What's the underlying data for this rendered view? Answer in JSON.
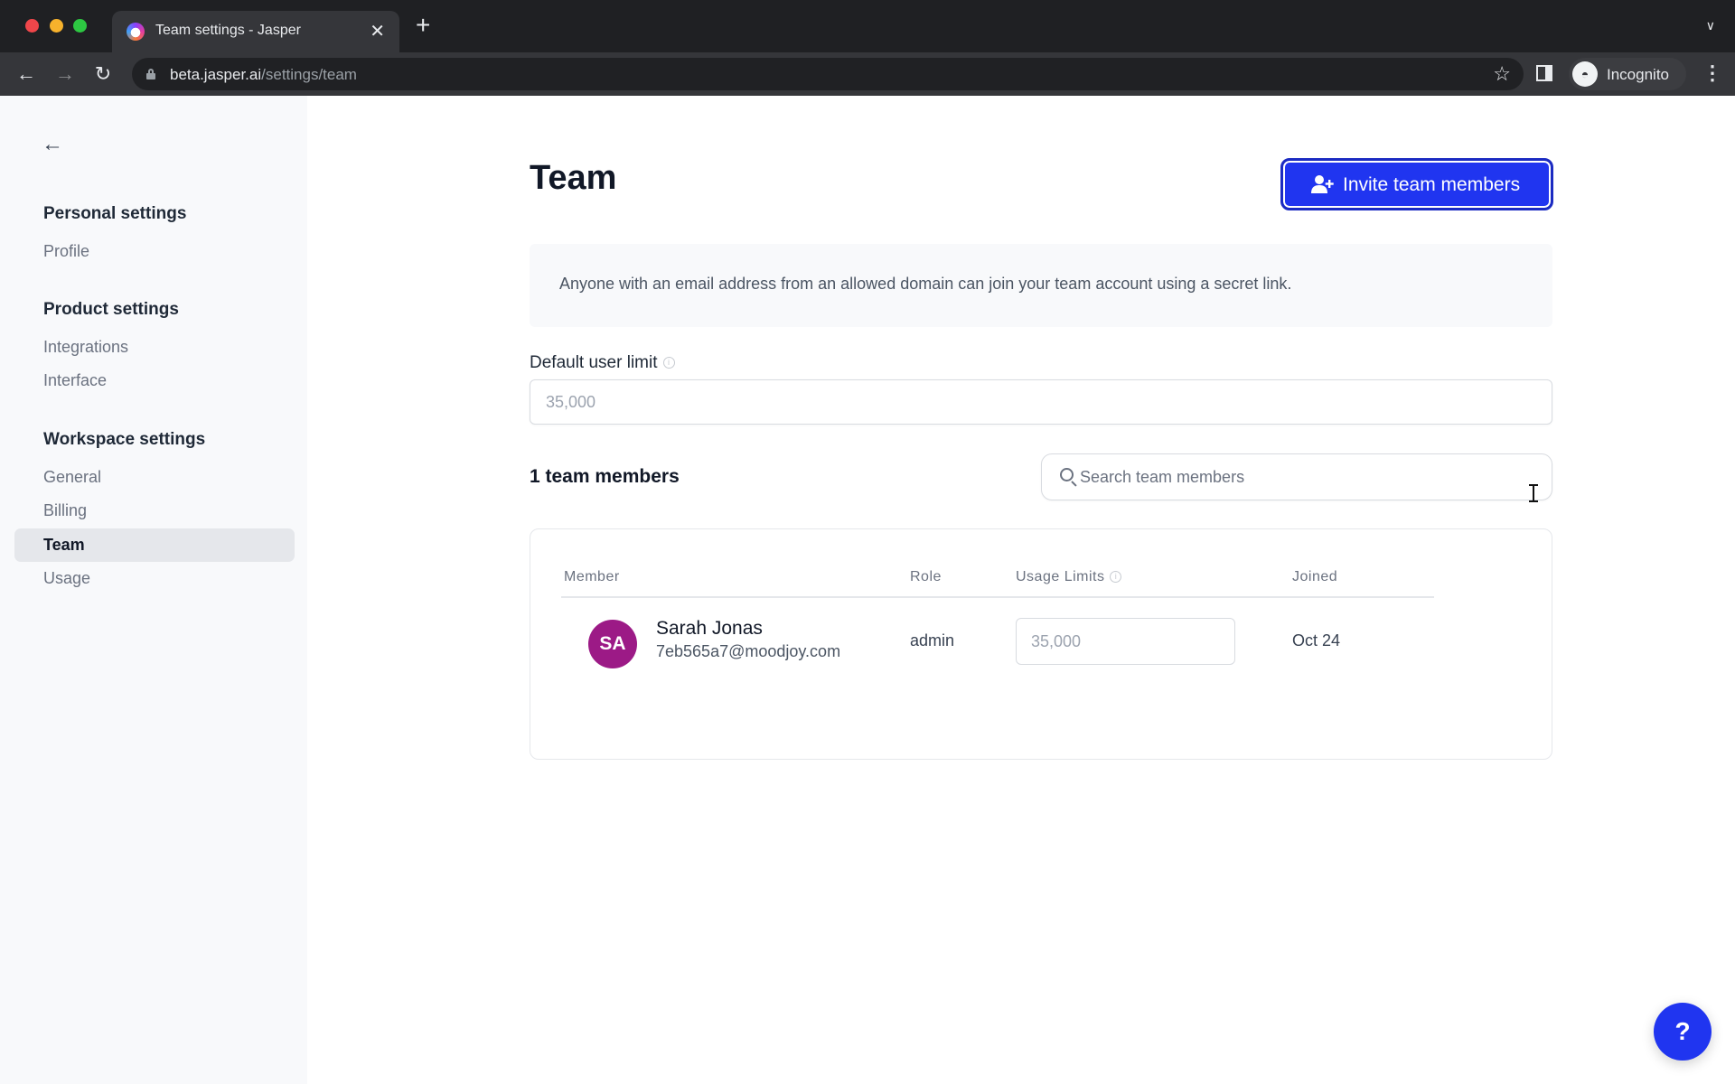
{
  "browser": {
    "tab_title": "Team settings - Jasper",
    "url_host": "beta.jasper.ai",
    "url_path": "/settings/team",
    "profile_label": "Incognito",
    "icons": {
      "back": "←",
      "forward": "→",
      "reload": "↻",
      "close_tab": "✕",
      "new_tab": "+",
      "tab_menu": "⌄",
      "bookmark": "☆",
      "menu": "⋮",
      "incognito": "◓"
    }
  },
  "sidebar": {
    "back_icon": "←",
    "sections": [
      {
        "title": "Personal settings",
        "items": [
          {
            "label": "Profile",
            "active": false
          }
        ]
      },
      {
        "title": "Product settings",
        "items": [
          {
            "label": "Integrations",
            "active": false
          },
          {
            "label": "Interface",
            "active": false
          }
        ]
      },
      {
        "title": "Workspace settings",
        "items": [
          {
            "label": "General",
            "active": false
          },
          {
            "label": "Billing",
            "active": false
          },
          {
            "label": "Team",
            "active": true
          },
          {
            "label": "Usage",
            "active": false
          }
        ]
      }
    ]
  },
  "main": {
    "title": "Team",
    "invite_button": "Invite team members",
    "info_text": "Anyone with an email address from an allowed domain can join your team account using a secret link.",
    "default_limit_label": "Default user limit",
    "default_limit_placeholder": "35,000",
    "members_count": "1 team members",
    "search_placeholder": "Search team members",
    "table": {
      "headers": {
        "member": "Member",
        "role": "Role",
        "usage": "Usage Limits",
        "joined": "Joined"
      },
      "rows": [
        {
          "initials": "SA",
          "name": "Sarah Jonas",
          "email": "7eb565a7@moodjoy.com",
          "role": "admin",
          "usage_placeholder": "35,000",
          "joined": "Oct 24"
        }
      ]
    },
    "help_label": "?"
  },
  "colors": {
    "accent": "#2035f0",
    "avatar": "#9c1a86",
    "sidebar_bg": "#f8f9fb",
    "active_item_bg": "#e5e7eb"
  }
}
